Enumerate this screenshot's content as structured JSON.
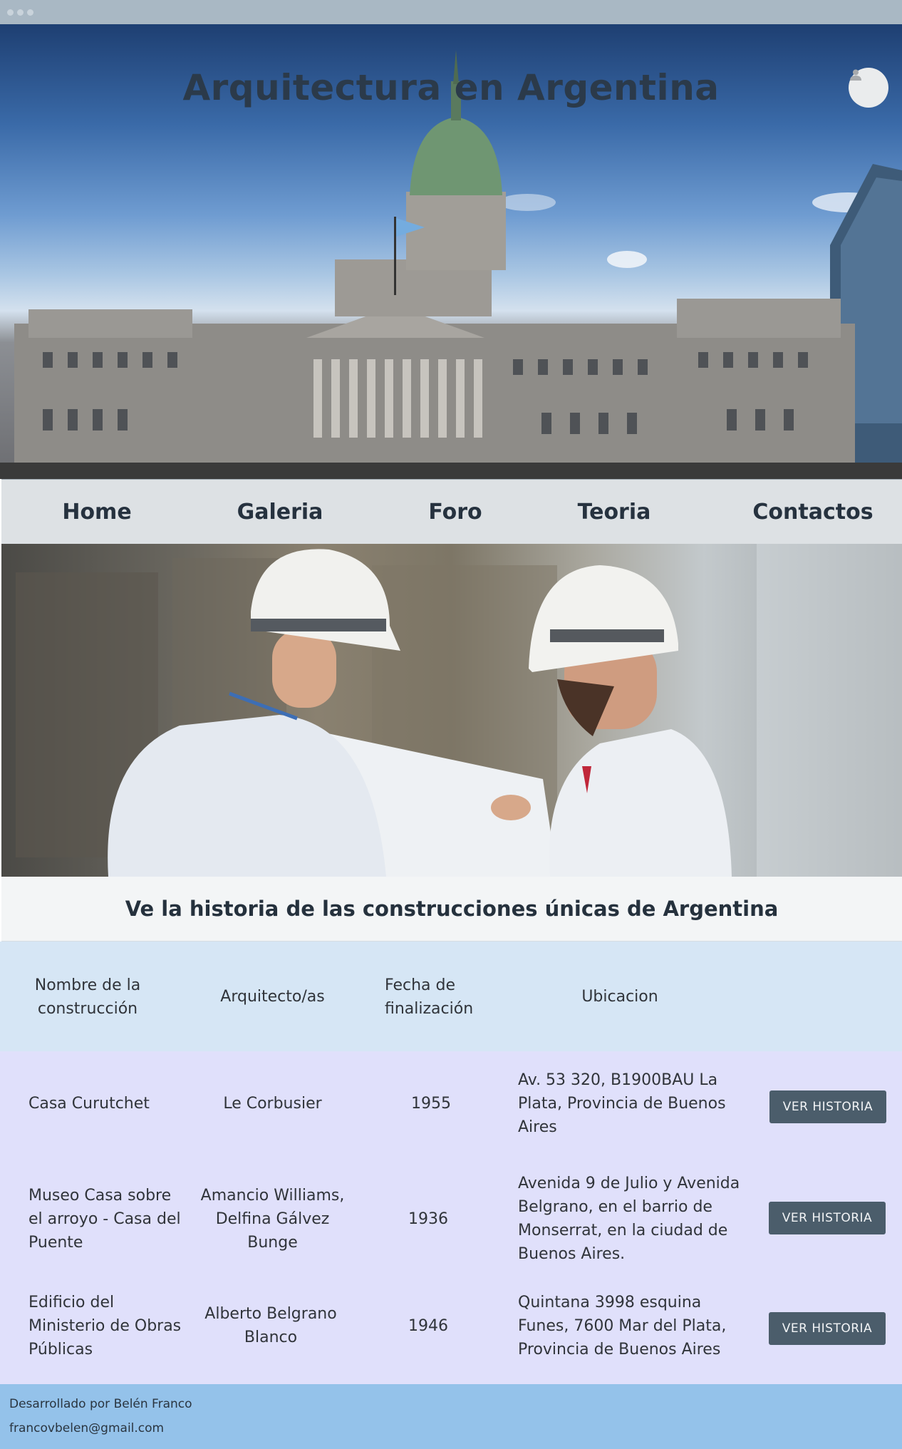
{
  "site": {
    "title": "Arquitectura en Argentina"
  },
  "nav": {
    "items": [
      {
        "label": "Home"
      },
      {
        "label": "Galeria"
      },
      {
        "label": "Foro"
      },
      {
        "label": "Teoria"
      },
      {
        "label": "Contactos"
      }
    ]
  },
  "tagline": "Ve la historia de las construcciones únicas de Argentina",
  "table": {
    "headers": {
      "name": "Nombre de la construcción",
      "architect": "Arquitecto/as",
      "date": "Fecha de finalización",
      "location": "Ubicacion"
    },
    "rows": [
      {
        "name": "Casa Curutchet",
        "architect": "Le Corbusier",
        "date": "1955",
        "location": "Av. 53 320, B1900BAU La Plata, Provincia de Buenos Aires",
        "button": "VER HISTORIA"
      },
      {
        "name": "Museo Casa sobre el arroyo - Casa del Puente",
        "architect": "Amancio Williams, Delfina Gálvez Bunge",
        "date": "1936",
        "location": "Avenida 9 de Julio y Avenida Belgrano, en el barrio de Monserrat, en la ciudad de Buenos Aires.",
        "button": "VER HISTORIA"
      },
      {
        "name": "Edificio del Ministerio de Obras Públicas",
        "architect": "Alberto Belgrano Blanco",
        "date": "1946",
        "location": "Quintana 3998 esquina Funes, 7600 Mar del Plata, Provincia de Buenos Aires",
        "button": "VER HISTORIA"
      }
    ]
  },
  "footer": {
    "developer": "Desarrollado por Belén Franco",
    "email": "francovbelen@gmail.com"
  },
  "icons": {
    "user": "user-icon"
  }
}
